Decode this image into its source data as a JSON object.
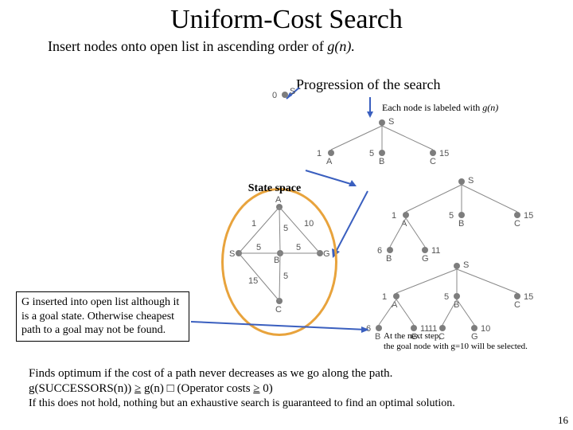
{
  "title": "Uniform-Cost Search",
  "subtitle_a": "Insert nodes onto open list in ascending order of ",
  "subtitle_b": "g(n).",
  "progression": "Progression of the search",
  "eachnode_a": "Each node is labeled with ",
  "eachnode_b": "g(n)",
  "state_space": "State space",
  "gnote": "G inserted into open list although it is a goal state. Otherwise cheapest path to a goal may not be found.",
  "nextstep_l1": "At the next step,",
  "nextstep_l2": "the goal node with g=10 will be selected.",
  "bottom_l1": "Finds optimum if the cost of a path never decreases as we go along the path.",
  "bottom_l2a": "g(SUCCESSORS(n)) ",
  "bottom_l2b": "≥",
  "bottom_l2c": " g(n)  □ (Operator costs ",
  "bottom_l2d": "≥",
  "bottom_l2e": " 0)",
  "bottom2": "If this does not hold, nothing but an exhaustive search is guaranteed to find an optimal solution.",
  "pagenum": "16",
  "graph": {
    "nodes": {
      "A": "A",
      "B": "B",
      "C": "C",
      "G": "G",
      "S": "S"
    },
    "edges": {
      "SA": "1",
      "SB": "5",
      "SC": "15",
      "AB": "5",
      "AG": "10",
      "BC": "5",
      "BG": "5"
    }
  },
  "trees": {
    "t1": {
      "S": "S",
      "v": "0"
    },
    "t2": {
      "S": "S",
      "A": "A",
      "B": "B",
      "C": "C",
      "va": "1",
      "vb": "5",
      "vc": "15"
    },
    "t3": {
      "S": "S",
      "A": "A",
      "B": "B",
      "C": "C",
      "B2": "B",
      "G": "G",
      "va": "1",
      "vb": "5",
      "vc": "15",
      "vb2": "6",
      "vg": "11"
    },
    "t4": {
      "S": "S",
      "A": "A",
      "B": "B",
      "C": "C",
      "B2": "B",
      "G": "G",
      "C2": "C",
      "G2": "G",
      "va": "1",
      "vb": "5",
      "vc": "15",
      "vb2": "6",
      "vg": "11",
      "vc2": "11",
      "vg2": "10"
    }
  }
}
